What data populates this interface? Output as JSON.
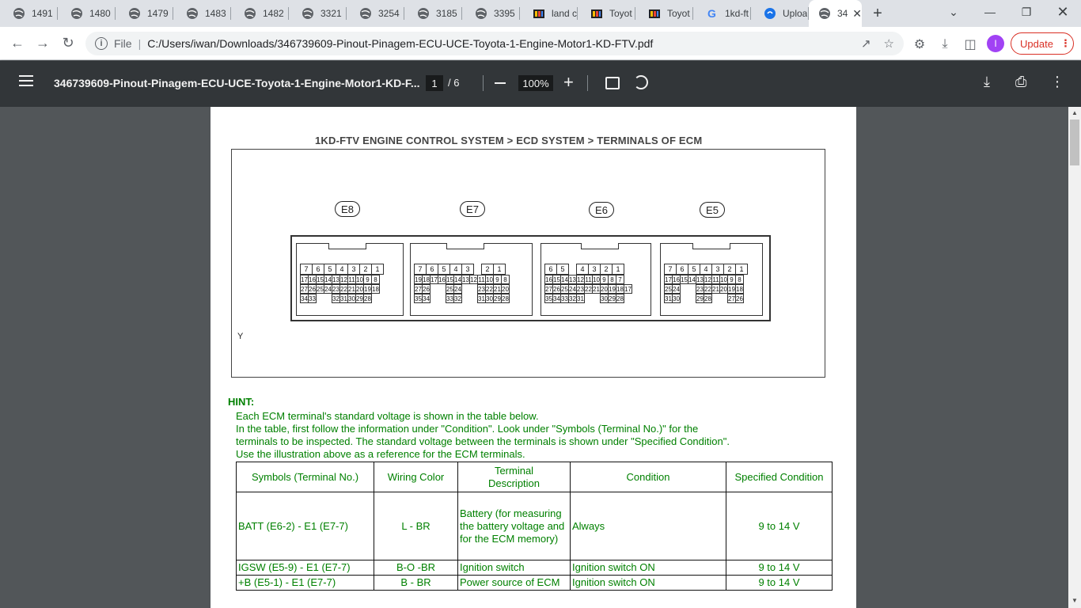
{
  "tabs": [
    {
      "label": "1491",
      "icon": "globe-icon"
    },
    {
      "label": "1480",
      "icon": "globe-icon"
    },
    {
      "label": "1479",
      "icon": "globe-icon"
    },
    {
      "label": "1483",
      "icon": "globe-icon"
    },
    {
      "label": "1482",
      "icon": "globe-icon"
    },
    {
      "label": "3321",
      "icon": "globe-icon"
    },
    {
      "label": "3254",
      "icon": "globe-icon"
    },
    {
      "label": "3185",
      "icon": "globe-icon"
    },
    {
      "label": "3395",
      "icon": "globe-icon"
    },
    {
      "label": "land c",
      "icon": "site-icon"
    },
    {
      "label": "Toyot",
      "icon": "site-icon"
    },
    {
      "label": "Toyot",
      "icon": "site-icon"
    },
    {
      "label": "1kd-ft",
      "icon": "google-icon"
    },
    {
      "label": "Uploa",
      "icon": "upload-site-icon"
    },
    {
      "label": "34",
      "icon": "globe-icon",
      "active": true
    }
  ],
  "address": {
    "scheme": "File",
    "url": "C:/Users/iwan/Downloads/346739609-Pinout-Pinagem-ECU-UCE-Toyota-1-Engine-Motor1-KD-FTV.pdf"
  },
  "profile": {
    "initial": "I",
    "update_label": "Update"
  },
  "pdf": {
    "title": "346739609-Pinout-Pinagem-ECU-UCE-Toyota-1-Engine-Motor1-KD-F...",
    "page_current": "1",
    "page_total": "/ 6",
    "zoom": "100%"
  },
  "doc": {
    "heading": "1KD-FTV ENGINE CONTROL SYSTEM  >  ECD SYSTEM  >  TERMINALS OF ECM",
    "connectors": [
      "E8",
      "E7",
      "E6",
      "E5"
    ],
    "figure_code": "Y",
    "hint_title": "HINT:",
    "hint_lines": [
      "Each ECM terminal's standard voltage is shown in the table below.",
      "In the table, first follow the information under \"Condition\". Look under \"Symbols (Terminal No.)\" for the",
      "terminals to be inspected. The standard voltage between the terminals is shown under \"Specified Condition\".",
      "Use the illustration above as a reference for the ECM terminals."
    ]
  },
  "pins": {
    "E8": [
      [
        "7",
        "6",
        "5",
        "4",
        "3",
        "2",
        "1"
      ],
      [
        "17",
        "16",
        "15",
        "14",
        "13",
        "12",
        "11",
        "10",
        "9",
        "8"
      ],
      [
        "27",
        "26",
        "25",
        "24",
        "23",
        "22",
        "21",
        "20",
        "19",
        "18"
      ],
      [
        "34",
        "33",
        "",
        "",
        "32",
        "31",
        "30",
        "29",
        "28"
      ]
    ],
    "E7": [
      [
        "7",
        "6",
        "5",
        "4",
        "3",
        "",
        "2",
        "1"
      ],
      [
        "19",
        "18",
        "17",
        "16",
        "15",
        "14",
        "13",
        "12",
        "11",
        "10",
        "9",
        "8"
      ],
      [
        "27",
        "26",
        "",
        "",
        "25",
        "24",
        "",
        "",
        "23",
        "22",
        "21",
        "20"
      ],
      [
        "35",
        "34",
        "",
        "",
        "33",
        "32",
        "",
        "",
        "31",
        "30",
        "29",
        "28"
      ]
    ],
    "E6": [
      [
        "6",
        "5",
        "",
        "4",
        "3",
        "2",
        "1"
      ],
      [
        "16",
        "15",
        "14",
        "13",
        "12",
        "11",
        "10",
        "9",
        "8",
        "7"
      ],
      [
        "27",
        "26",
        "25",
        "24",
        "23",
        "22",
        "21",
        "20",
        "19",
        "18",
        "17"
      ],
      [
        "35",
        "34",
        "33",
        "32",
        "31",
        "",
        "",
        "30",
        "29",
        "28"
      ]
    ],
    "E5": [
      [
        "7",
        "6",
        "5",
        "4",
        "3",
        "2",
        "1"
      ],
      [
        "17",
        "16",
        "15",
        "14",
        "13",
        "12",
        "11",
        "10",
        "9",
        "8"
      ],
      [
        "25",
        "24",
        "",
        "",
        "23",
        "22",
        "21",
        "20",
        "19",
        "18"
      ],
      [
        "31",
        "30",
        "",
        "",
        "29",
        "28",
        "",
        "",
        "27",
        "26"
      ]
    ]
  },
  "table": {
    "headers": [
      "Symbols (Terminal No.)",
      "Wiring Color",
      "Terminal Description",
      "Condition",
      "Specified Condition"
    ],
    "rows": [
      [
        "BATT (E6-2) - E1 (E7-7)",
        "L - BR",
        "Battery (for measuring the battery voltage and for the ECM memory)",
        "Always",
        "9 to 14 V"
      ],
      [
        "IGSW (E5-9) - E1 (E7-7)",
        "B-O -BR",
        "Ignition switch",
        "Ignition switch ON",
        "9 to 14 V"
      ],
      [
        "+B (E5-1) - E1 (E7-7)",
        "B - BR",
        "Power source of ECM",
        "Ignition switch ON",
        "9 to 14 V"
      ]
    ]
  }
}
